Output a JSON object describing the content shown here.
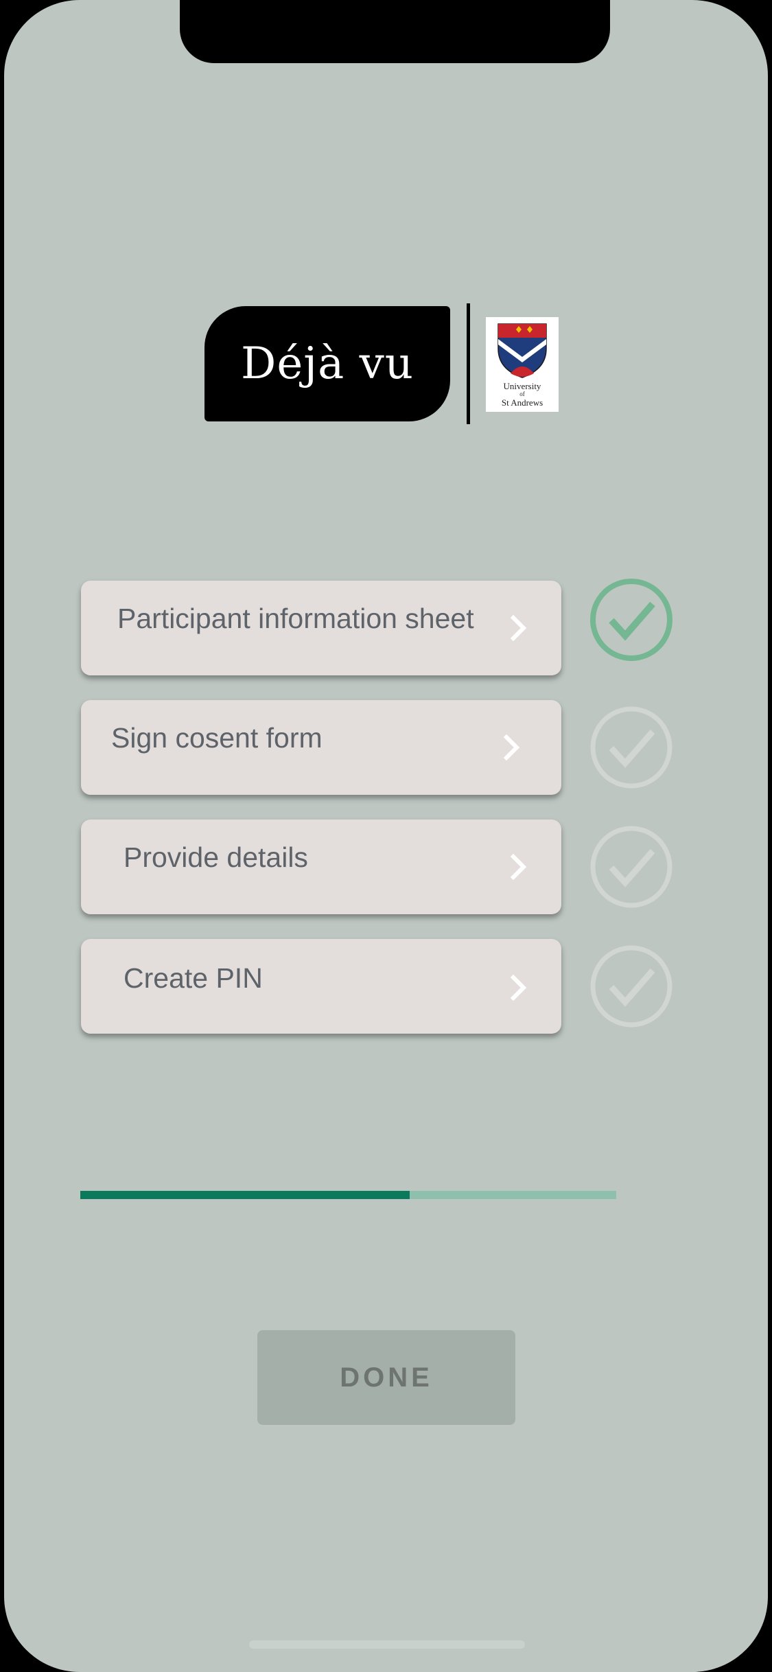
{
  "app": {
    "logo_text": "Déjà vu",
    "crest_line1": "University",
    "crest_line2": "of",
    "crest_line3": "St Andrews"
  },
  "steps": [
    {
      "label": "Participant information sheet",
      "completed": true
    },
    {
      "label": "Sign cosent form",
      "completed": false
    },
    {
      "label": "Provide details",
      "completed": false
    },
    {
      "label": "Create PIN",
      "completed": false
    }
  ],
  "progress": {
    "fraction": 0.615
  },
  "done_button": {
    "label": "DONE",
    "enabled": false
  },
  "colors": {
    "background": "#bdc6c1",
    "card": "#e3dedb",
    "check_done": "#75b792",
    "check_pending": "#d1d6d3",
    "progress_fill": "#0b7a5c",
    "progress_track": "#8fbfad"
  },
  "icons": {
    "chevron": "chevron-right-icon",
    "check": "check-circle-icon"
  }
}
